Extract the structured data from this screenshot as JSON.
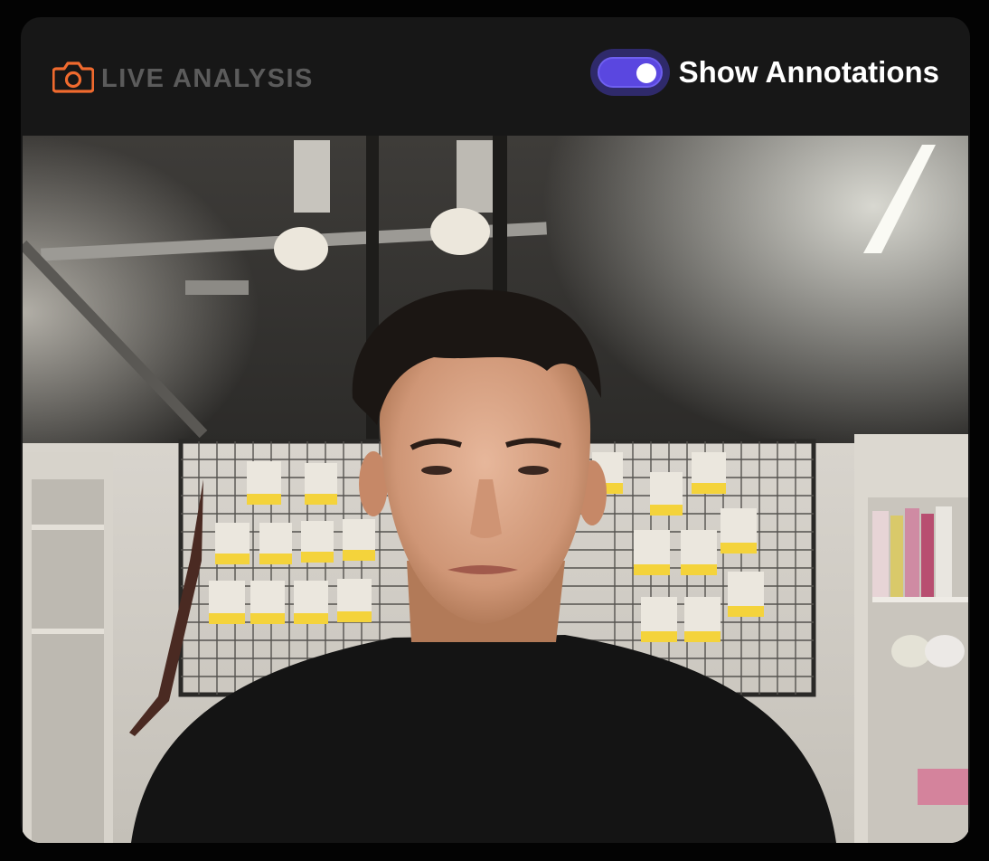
{
  "header": {
    "title": "LIVE ANALYSIS",
    "title_icon": "camera-icon",
    "toggle": {
      "label": "Show Annotations",
      "state": "on"
    }
  },
  "colors": {
    "accent_orange": "#f06a2e",
    "title_gray": "#5b5b5b",
    "toggle_on": "#5a47e0",
    "toggle_bg": "#2f2a6b",
    "card_bg": "#171717",
    "page_bg": "#030303"
  },
  "video": {
    "content": "live-camera-feed"
  }
}
